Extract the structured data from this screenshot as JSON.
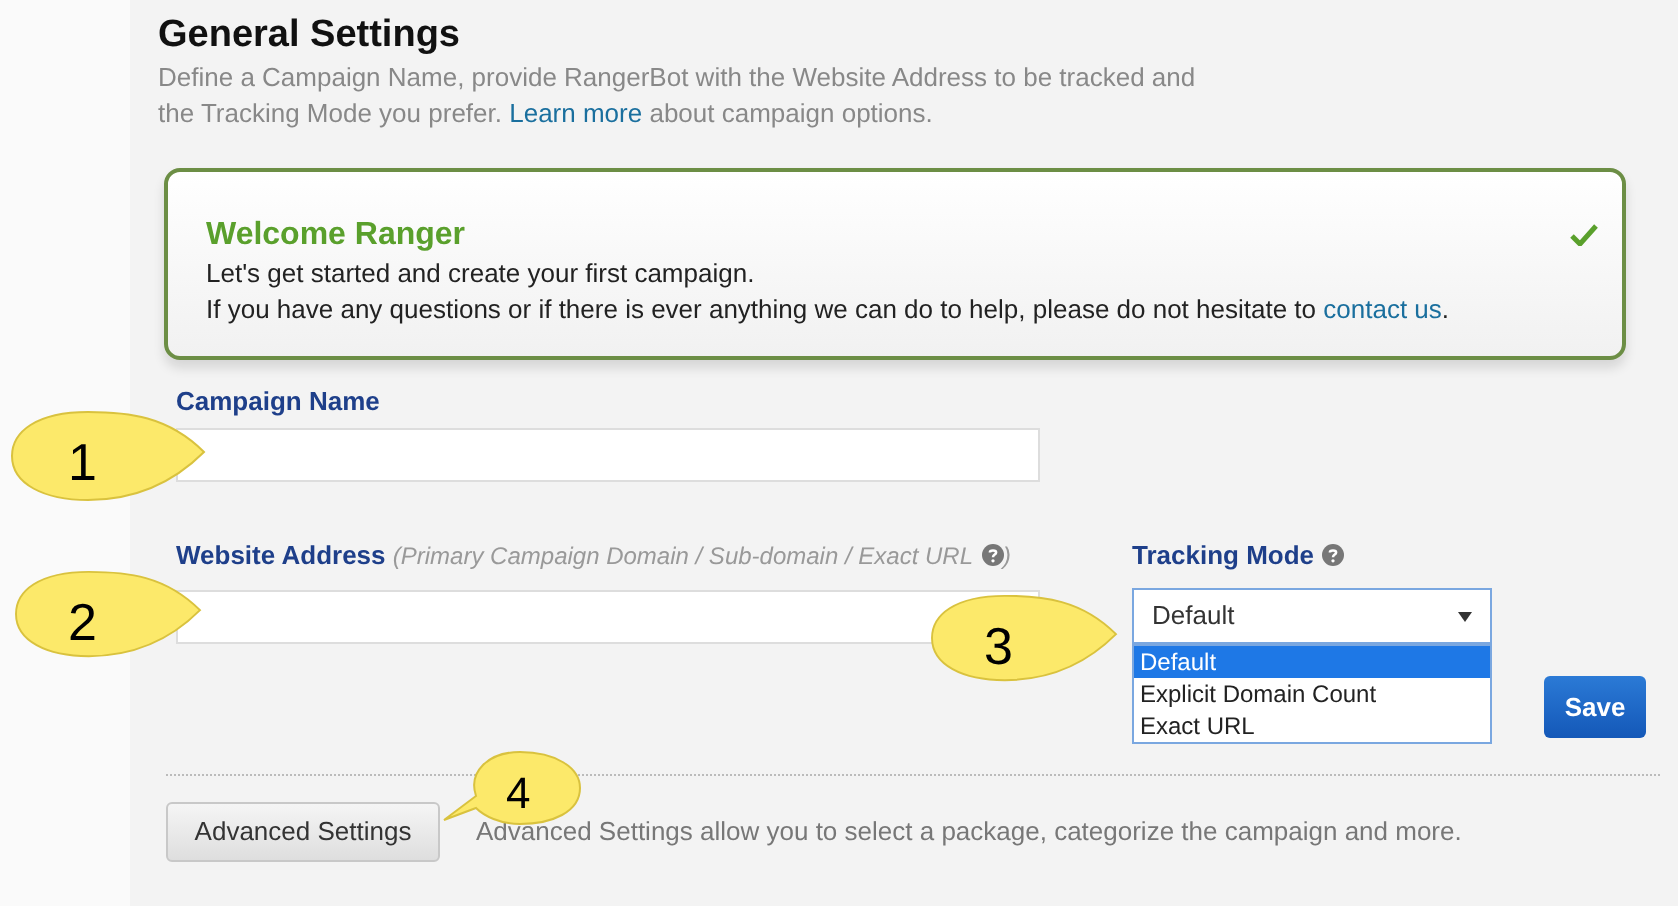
{
  "header": {
    "title": "General Settings",
    "description": {
      "before": "Define a Campaign Name, provide RangerBot with the Website Address to be tracked and the Tracking Mode you prefer.",
      "link": "Learn more",
      "after": "about campaign options."
    }
  },
  "welcome": {
    "title": "Welcome Ranger",
    "line_1": "Let's get started and create your first campaign.",
    "line_2": {
      "before": "If you have any questions or if there is ever anything we can do to help, please do not hesitate to",
      "link": "contact us",
      "after": "."
    }
  },
  "campaign_name": {
    "label": "Campaign Name"
  },
  "website_address": {
    "label": "Website Address",
    "hint": "(Primary Campaign Domain / Sub-domain / Exact URL",
    "hint_end": ")"
  },
  "tracking_mode": {
    "label": "Tracking Mode",
    "value": "Default",
    "options": [
      {
        "label": "Default",
        "selected": true
      },
      {
        "label": "Explicit Domain Count",
        "selected": false
      },
      {
        "label": "Exact URL",
        "selected": false
      }
    ]
  },
  "save_button": "Save",
  "advanced": {
    "button": "Advanced Settings",
    "note": "Advanced Settings allow you to select a package, categorize the campaign and more."
  },
  "callouts": [
    {
      "number": "1"
    },
    {
      "number": "2"
    },
    {
      "number": "3"
    },
    {
      "number": "4"
    }
  ]
}
